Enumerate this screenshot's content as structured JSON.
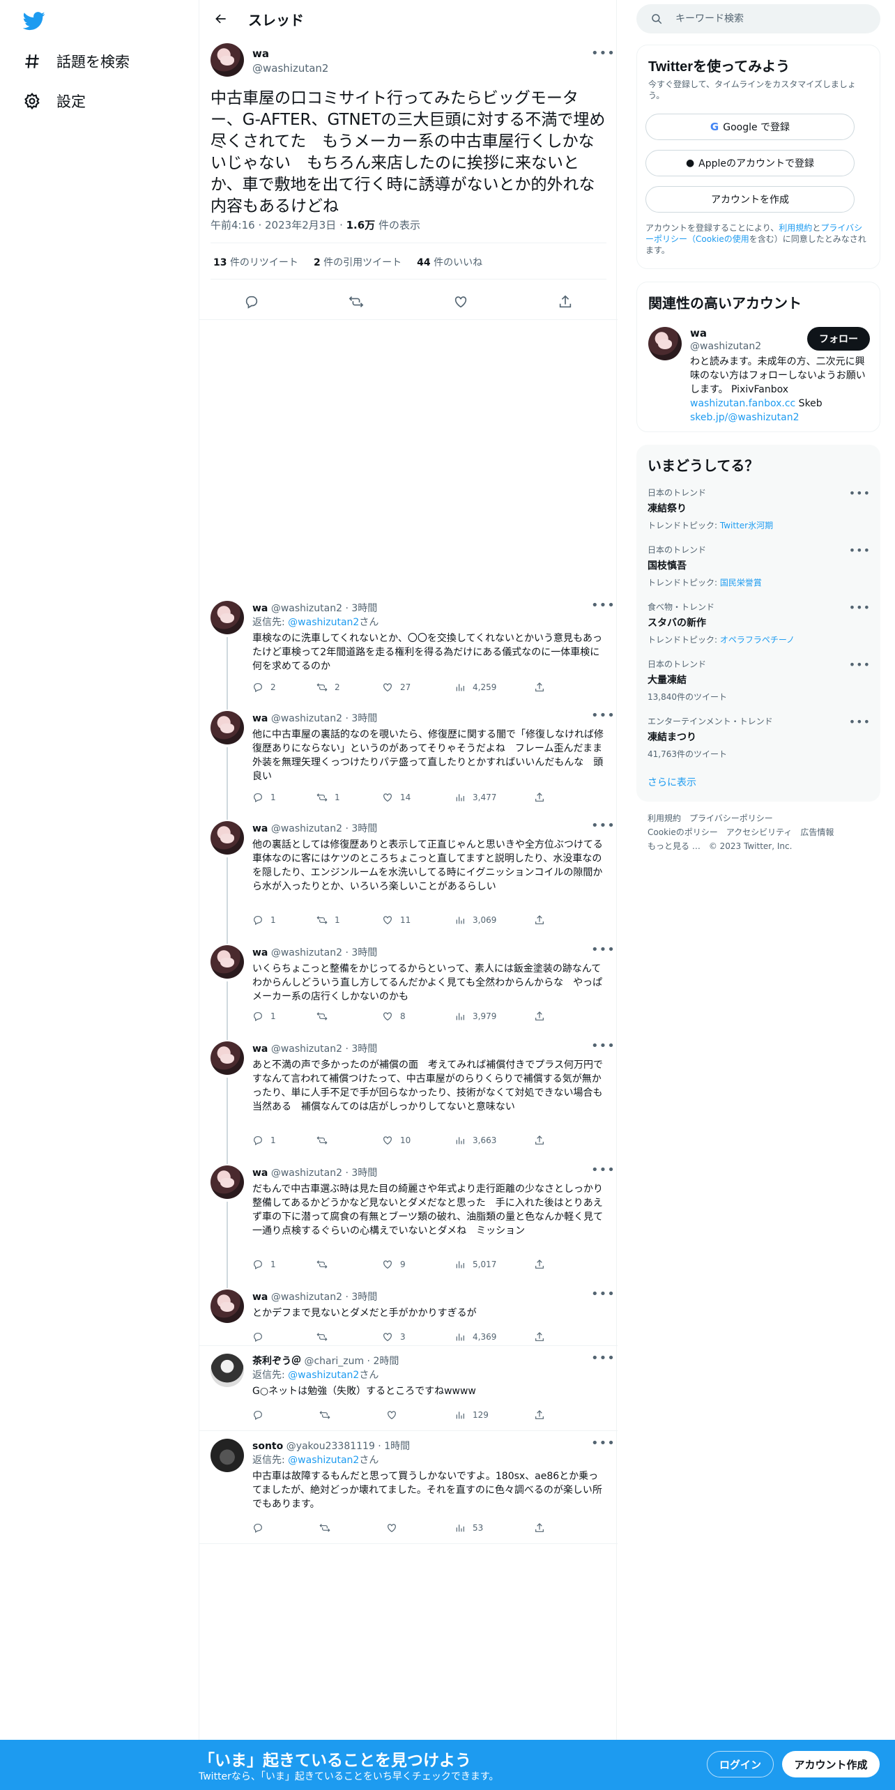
{
  "nav": {
    "explore_label": "話題を検索",
    "settings_label": "設定"
  },
  "header": {
    "title": "スレッド"
  },
  "main_tweet": {
    "name": "wa",
    "handle": "@washizutan2",
    "text": "中古車屋の口コミサイト行ってみたらビッグモーター、G-AFTER、GTNETの三大巨頭に対する不満で埋め尽くされてた　もうメーカー系の中古車屋行くしかないじゃない　もちろん来店したのに挨拶に来ないとか、車で敷地を出て行く時に誘導がないとか的外れな内容もあるけどね",
    "time": "午前4:16",
    "date": "2023年2月3日",
    "views": "1.6万",
    "views_suffix": "件の表示",
    "retweets": "13",
    "retweets_label": "件のリツイート",
    "quotes": "2",
    "quotes_label": "件の引用ツイート",
    "likes": "44",
    "likes_label": "件のいいね"
  },
  "replies": [
    {
      "name": "wa",
      "handle": "@washizutan2",
      "time": "3時間",
      "reply_to": "@washizutan2",
      "reply_prefix": "返信先:",
      "reply_suffix": "さん",
      "text": "車検なのに洗車してくれないとか、〇〇を交換してくれないとかいう意見もあったけど車検って2年間道路を走る権利を得る為だけにある儀式なのに一体車検に何を求めてるのか",
      "replies": "2",
      "retweets": "2",
      "likes": "27",
      "views": "4,259"
    },
    {
      "name": "wa",
      "handle": "@washizutan2",
      "time": "3時間",
      "text": "他に中古車屋の裏話的なのを覗いたら、修復歴に関する闇で「修復しなければ修復歴ありにならない」というのがあってそりゃそうだよね　フレーム歪んだまま外装を無理矢理くっつけたりパテ盛って直したりとかすればいいんだもんな　頭良い",
      "replies": "1",
      "retweets": "1",
      "likes": "14",
      "views": "3,477"
    },
    {
      "name": "wa",
      "handle": "@washizutan2",
      "time": "3時間",
      "text": "他の裏話としては修復歴ありと表示して正直じゃんと思いきや全方位ぶつけてる車体なのに客にはケツのところちょこっと直してますと説明したり、水没車なのを隠したり、エンジンルームを水洗いしてる時にイグニッションコイルの隙間から水が入ったりとか、いろいろ楽しいことがあるらしい",
      "replies": "1",
      "retweets": "1",
      "likes": "11",
      "views": "3,069"
    },
    {
      "name": "wa",
      "handle": "@washizutan2",
      "time": "3時間",
      "text": "いくらちょこっと整備をかじってるからといって、素人には鈑金塗装の跡なんてわからんしどういう直し方してるんだかよく見ても全然わからんからな　やっぱメーカー系の店行くしかないのかも",
      "replies": "1",
      "retweets": "",
      "likes": "8",
      "views": "3,979"
    },
    {
      "name": "wa",
      "handle": "@washizutan2",
      "time": "3時間",
      "text": "あと不満の声で多かったのが補償の面　考えてみれば補償付きでプラス何万円ですなんて言われて補償つけたって、中古車屋がのらりくらりで補償する気が無かったり、単に人手不足で手が回らなかったり、技術がなくて対処できない場合も当然ある　補償なんてのは店がしっかりしてないと意味ない",
      "replies": "1",
      "retweets": "",
      "likes": "10",
      "views": "3,663"
    },
    {
      "name": "wa",
      "handle": "@washizutan2",
      "time": "3時間",
      "text": "だもんで中古車選ぶ時は見た目の綺麗さや年式より走行距離の少なさとしっかり整備してあるかどうかなど見ないとダメだなと思った　手に入れた後はとりあえず車の下に潜って腐食の有無とブーツ類の破れ、油脂類の量と色なんか軽く見て一通り点検するぐらいの心構えでいないとダメね　ミッション",
      "replies": "1",
      "retweets": "",
      "likes": "9",
      "views": "5,017"
    },
    {
      "name": "wa",
      "handle": "@washizutan2",
      "time": "3時間",
      "text": "とかデフまで見ないとダメだと手がかかりすぎるが",
      "replies": "",
      "retweets": "",
      "likes": "3",
      "views": "4,369"
    },
    {
      "name": "茶利ぞう＠",
      "handle": "@chari_zum",
      "time": "2時間",
      "reply_to": "@washizutan2",
      "reply_prefix": "返信先:",
      "reply_suffix": "さん",
      "text": "G○ネットは勉強（失敗）するところですねwwww",
      "replies": "",
      "retweets": "",
      "likes": "",
      "views": "129"
    },
    {
      "name": "sonto",
      "handle": "@yakou23381119",
      "time": "1時間",
      "reply_to": "@washizutan2",
      "reply_prefix": "返信先:",
      "reply_suffix": "さん",
      "text": "中古車は故障するもんだと思って買うしかないですよ。180sx、ae86とか乗ってましたが、絶対どっか壊れてました。それを直すのに色々調べるのが楽しい所でもあります。",
      "replies": "",
      "retweets": "",
      "likes": "",
      "views": "53"
    }
  ],
  "search": {
    "placeholder": "キーワード検索"
  },
  "signup": {
    "title": "Twitterを使ってみよう",
    "subtitle": "今すぐ登録して、タイムラインをカスタマイズしましょう。",
    "google_label": "Google で登録",
    "apple_label": "Appleのアカウントで登録",
    "create_label": "アカウントを作成",
    "legal_1": "アカウントを登録することにより、",
    "legal_terms": "利用規約",
    "legal_and": "と",
    "legal_privacy": "プライバシーポリシー",
    "legal_cookie": "（Cookieの使用",
    "legal_2": "を含む）に同意したとみなされます。"
  },
  "related": {
    "title": "関連性の高いアカウント",
    "name": "wa",
    "handle": "@washizutan2",
    "follow_label": "フォロー",
    "bio": "わと読みます。未成年の方、二次元に興味のない方はフォローしないようお願いします。 PixivFanbox",
    "link1": "washizutan.fanbox.cc",
    "mid": " Skeb",
    "link2": "skeb.jp/@washizutan2"
  },
  "trends": {
    "title": "いまどうしてる？",
    "items": [
      {
        "category": "日本のトレンド",
        "name": "凍結祭り",
        "sub_prefix": "トレンドトピック: ",
        "sub_link": "Twitter氷河期",
        "sub": ""
      },
      {
        "category": "日本のトレンド",
        "name": "国枝慎吾",
        "sub_prefix": "トレンドトピック: ",
        "sub_link": "国民栄誉賞",
        "sub": ""
      },
      {
        "category": "食べ物・トレンド",
        "name": "スタバの新作",
        "sub_prefix": "トレンドトピック: ",
        "sub_link": "オペラフラペチーノ",
        "sub": ""
      },
      {
        "category": "日本のトレンド",
        "name": "大量凍結",
        "sub_prefix": "",
        "sub_link": "",
        "sub": "13,840件のツイート"
      },
      {
        "category": "エンターテインメント・トレンド",
        "name": "凍結まつり",
        "sub_prefix": "",
        "sub_link": "",
        "sub": "41,763件のツイート"
      }
    ],
    "show_more": "さらに表示"
  },
  "footer": {
    "terms": "利用規約",
    "privacy": "プライバシーポリシー",
    "cookie": "Cookieのポリシー",
    "accessibility": "アクセシビリティ",
    "ads": "広告情報",
    "more": "もっと見る …",
    "copyright": "© 2023 Twitter, Inc."
  },
  "bottom_bar": {
    "title": "「いま」起きていることを見つけよう",
    "subtitle": "Twitterなら、「いま」起きていることをいち早くチェックできます。",
    "login_label": "ログイン",
    "signup_label": "アカウント作成"
  },
  "colors": {
    "accent": "#1d9bf0",
    "text": "#0f1419",
    "muted": "#536471"
  }
}
